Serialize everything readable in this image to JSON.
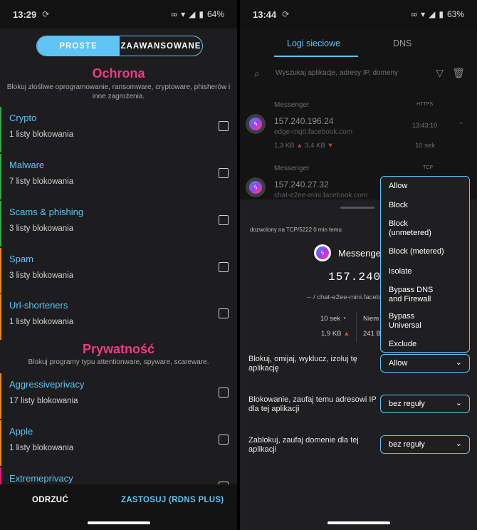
{
  "left": {
    "status": {
      "time": "13:29",
      "battery": "64%"
    },
    "segment": {
      "simple": "PROSTE",
      "advanced": "ZAAWANSOWANE"
    },
    "protection": {
      "title": "Ochrona",
      "desc": "Blokuj złośliwe oprogramowanie, ransomware, cryptoware, phisherów i inne zagrożenia.",
      "items": [
        {
          "name": "Crypto",
          "sub": "1 listy blokowania"
        },
        {
          "name": "Malware",
          "sub": "7 listy blokowania"
        },
        {
          "name": "Scams & phishing",
          "sub": "3 listy blokowania"
        },
        {
          "name": "Spam",
          "sub": "3 listy blokowania"
        },
        {
          "name": "Url-shorteners",
          "sub": "1 listy blokowania"
        }
      ]
    },
    "privacy": {
      "title": "Prywatność",
      "desc": "Blokuj programy typu attentionware, spyware, scareware.",
      "items": [
        {
          "name": "Aggressiveprivacy",
          "sub": "17 listy blokowania"
        },
        {
          "name": "Apple",
          "sub": "1 listy blokowania"
        },
        {
          "name": "Extremeprivacy",
          "sub": ""
        }
      ]
    },
    "bottom": {
      "cancel": "ODRZUĆ",
      "apply": "ZASTOSUJ (RDNS PLUS)"
    }
  },
  "right": {
    "status": {
      "time": "13:44",
      "battery": "63%"
    },
    "tabs": {
      "logs": "Logi sieciowe",
      "dns": "DNS"
    },
    "search": {
      "placeholder": "Wyszukaj aplikacje, adresy IP, domeny"
    },
    "connections": [
      {
        "app": "Messenger",
        "proto": "HTTPS",
        "ip": "157.240.196.24",
        "host": "edge-mqtt.facebook.com",
        "time": "13:43:10",
        "down": "1,3 KB",
        "up": "3,4 KB",
        "dur": "10 sek"
      },
      {
        "app": "Messenger",
        "proto": "TCP",
        "ip": "157.240.27.32",
        "host": "chat-e2ee-mini.facebook.com"
      }
    ],
    "sheet": {
      "meta": "dozwolony na TCP/5222 0 min temu",
      "app": "Messenge",
      "ip": "157.240.2",
      "host": "-- / chat-e2ee-mini.faceb",
      "dur": "10 sek",
      "type": "Niem",
      "size": "1,9 KB",
      "size2": "241 B",
      "rules": [
        {
          "label": "Blokuj, omijaj, wyklucz, izoluj tę aplikację",
          "value": "Allow"
        },
        {
          "label": "Blokowanie, zaufaj temu adresowi IP dla tej aplikacji",
          "value": "bez reguły"
        },
        {
          "label": "Zablokuj, zaufaj domenie dla tej aplikacji",
          "value": "bez reguły"
        }
      ],
      "menu": [
        "Allow",
        "Block",
        "Block (unmetered)",
        "Block (metered)",
        "Isolate",
        "Bypass DNS and Firewall",
        "Bypass Universal",
        "Exclude"
      ]
    }
  }
}
